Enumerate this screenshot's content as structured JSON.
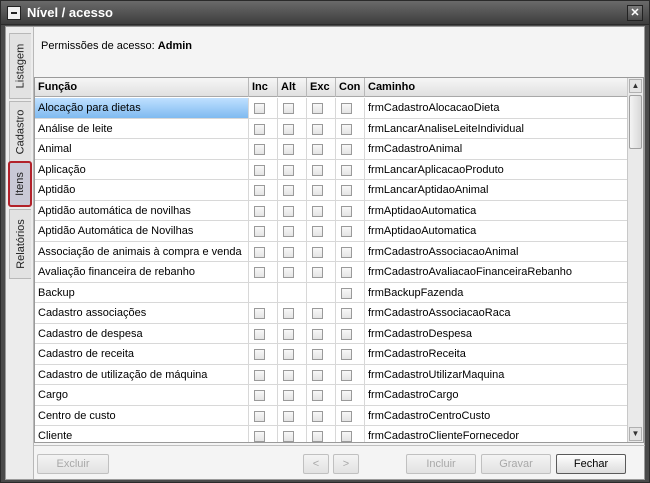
{
  "window": {
    "title": "Nível / acesso",
    "close_glyph": "✕"
  },
  "tabs": [
    {
      "label": "Listagem"
    },
    {
      "label": "Cadastro"
    },
    {
      "label": "Itens"
    },
    {
      "label": "Relatórios"
    }
  ],
  "permissions": {
    "prefix": "Permissões de acesso:",
    "level": "Admin"
  },
  "grid": {
    "columns": [
      "Função",
      "Inc",
      "Alt",
      "Exc",
      "Con",
      "Caminho"
    ],
    "rows": [
      {
        "funcao": "Alocação para dietas",
        "caminho": "frmCadastroAlocacaoDieta",
        "selected": true,
        "checkboxes": 4
      },
      {
        "funcao": "Análise de leite",
        "caminho": "frmLancarAnaliseLeiteIndividual",
        "checkboxes": 4
      },
      {
        "funcao": "Animal",
        "caminho": "frmCadastroAnimal",
        "checkboxes": 4
      },
      {
        "funcao": "Aplicação",
        "caminho": "frmLancarAplicacaoProduto",
        "checkboxes": 4
      },
      {
        "funcao": "Aptidão",
        "caminho": "frmLancarAptidaoAnimal",
        "checkboxes": 4
      },
      {
        "funcao": "Aptidão automática de novilhas",
        "caminho": "frmAptidaoAutomatica",
        "checkboxes": 4
      },
      {
        "funcao": "Aptidão Automática de Novilhas",
        "caminho": "frmAptidaoAutomatica",
        "checkboxes": 4
      },
      {
        "funcao": "Associação de animais à compra e venda",
        "caminho": "frmCadastroAssociacaoAnimal",
        "checkboxes": 4
      },
      {
        "funcao": "Avaliação financeira de rebanho",
        "caminho": "frmCadastroAvaliacaoFinanceiraRebanho",
        "checkboxes": 4
      },
      {
        "funcao": "Backup",
        "caminho": "frmBackupFazenda",
        "checkboxes": 1
      },
      {
        "funcao": "Cadastro associações",
        "caminho": "frmCadastroAssociacaoRaca",
        "checkboxes": 4
      },
      {
        "funcao": "Cadastro de despesa",
        "caminho": "frmCadastroDespesa",
        "checkboxes": 4
      },
      {
        "funcao": "Cadastro de receita",
        "caminho": "frmCadastroReceita",
        "checkboxes": 4
      },
      {
        "funcao": "Cadastro de utilização de máquina",
        "caminho": "frmCadastroUtilizarMaquina",
        "checkboxes": 4
      },
      {
        "funcao": "Cargo",
        "caminho": "frmCadastroCargo",
        "checkboxes": 4
      },
      {
        "funcao": "Centro de custo",
        "caminho": "frmCadastroCentroCusto",
        "checkboxes": 4
      },
      {
        "funcao": "Cliente",
        "caminho": "frmCadastroClienteFornecedor",
        "checkboxes": 4
      }
    ]
  },
  "scroll": {
    "up": "▲",
    "down": "▼"
  },
  "footer": {
    "excluir": "Excluir",
    "prev": "<",
    "next": ">",
    "incluir": "Incluir",
    "gravar": "Gravar",
    "fechar": "Fechar"
  }
}
